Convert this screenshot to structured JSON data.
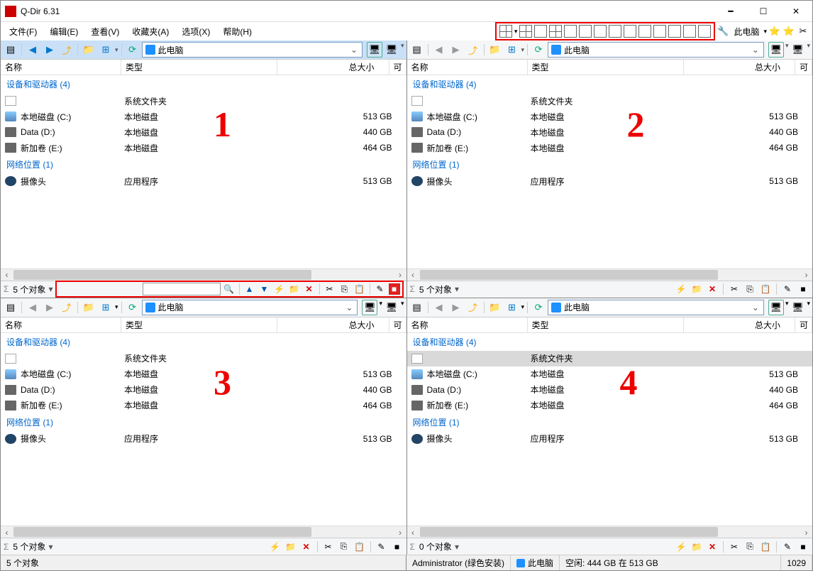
{
  "app": {
    "title": "Q-Dir 6.31"
  },
  "menu": [
    "文件(F)",
    "编辑(E)",
    "查看(V)",
    "收藏夹(A)",
    "选项(X)",
    "帮助(H)"
  ],
  "topRight": {
    "location": "此电脑"
  },
  "addr": {
    "text": "此电脑"
  },
  "columns": {
    "name": "名称",
    "type": "类型",
    "size": "总大小",
    "tail": "可"
  },
  "group1": "设备和驱动器 (4)",
  "group2": "网络位置 (1)",
  "rows": [
    {
      "icon": "folder",
      "name": "",
      "type": "系统文件夹",
      "size": ""
    },
    {
      "icon": "disk",
      "name": "本地磁盘 (C:)",
      "type": "本地磁盘",
      "size": "513 GB"
    },
    {
      "icon": "hdd",
      "name": "Data (D:)",
      "type": "本地磁盘",
      "size": "440 GB"
    },
    {
      "icon": "hdd",
      "name": "新加卷 (E:)",
      "type": "本地磁盘",
      "size": "464 GB"
    }
  ],
  "rows2": [
    {
      "icon": "cam",
      "name": "摄像头",
      "type": "应用程序",
      "size": "513 GB"
    }
  ],
  "status5": "5 个对象",
  "status0": "0 个对象",
  "bottom": {
    "left": "5 个对象",
    "admin": "Administrator (绿色安装)",
    "loc": "此电脑",
    "space": "空闲: 444 GB 在 513 GB",
    "num": "1029"
  },
  "annotations": [
    "1",
    "2",
    "3",
    "4"
  ]
}
